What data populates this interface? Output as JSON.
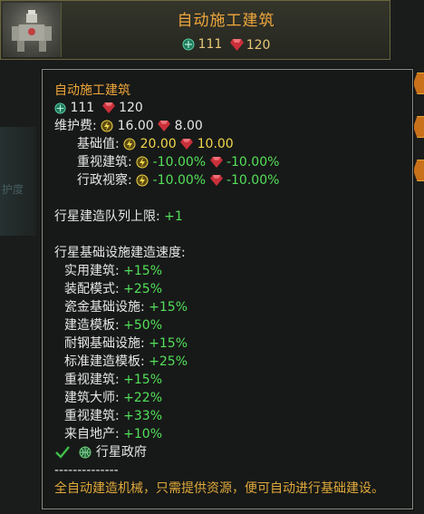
{
  "header": {
    "title": "自动施工建筑",
    "cost": {
      "influence": "111",
      "alloys": "120"
    }
  },
  "background": {
    "left_hint_text": "护度"
  },
  "tooltip": {
    "title": "自动施工建筑",
    "cost": {
      "influence": "111",
      "alloys": "120"
    },
    "upkeep_label": "维护费:",
    "upkeep": {
      "energy": "16.00",
      "alloys": "8.00"
    },
    "base_label": "基础值:",
    "base": {
      "energy": "20.00",
      "alloys": "10.00"
    },
    "rows_modifiers": [
      {
        "label": "重视建筑:",
        "energy": "-10.00%",
        "alloys": "-10.00%"
      },
      {
        "label": "行政视察:",
        "energy": "-10.00%",
        "alloys": "-10.00%"
      }
    ],
    "queue_label": "行星建造队列上限:",
    "queue_value": "+1",
    "speed_header": "行星基础设施建造速度:",
    "speed_rows": [
      {
        "label": "实用建筑:",
        "value": "+15%"
      },
      {
        "label": "装配模式:",
        "value": "+25%"
      },
      {
        "label": "瓷金基础设施:",
        "value": "+15%"
      },
      {
        "label": "建造模板:",
        "value": "+50%"
      },
      {
        "label": "耐钢基础设施:",
        "value": "+15%"
      },
      {
        "label": "标准建造模板:",
        "value": "+25%"
      },
      {
        "label": "重视建筑:",
        "value": "+15%"
      },
      {
        "label": "建筑大师:",
        "value": "+22%"
      },
      {
        "label": "重视建筑:",
        "value": "+33%"
      },
      {
        "label": "来自地产:",
        "value": "+10%"
      }
    ],
    "requirement": "行星政府",
    "separator": "--------------",
    "description": "全自动建造机械，只需提供资源，便可自动进行基础建设。"
  },
  "colors": {
    "title_orange": "#f0a73c",
    "positive_green": "#53e05a",
    "energy_gold": "#f2d64b",
    "alloy_red": "#d8323c",
    "influence_teal": "#2aa57e"
  },
  "icons": [
    "influence-icon",
    "alloy-icon",
    "energy-icon",
    "checkmark-icon",
    "planet-government-icon"
  ]
}
